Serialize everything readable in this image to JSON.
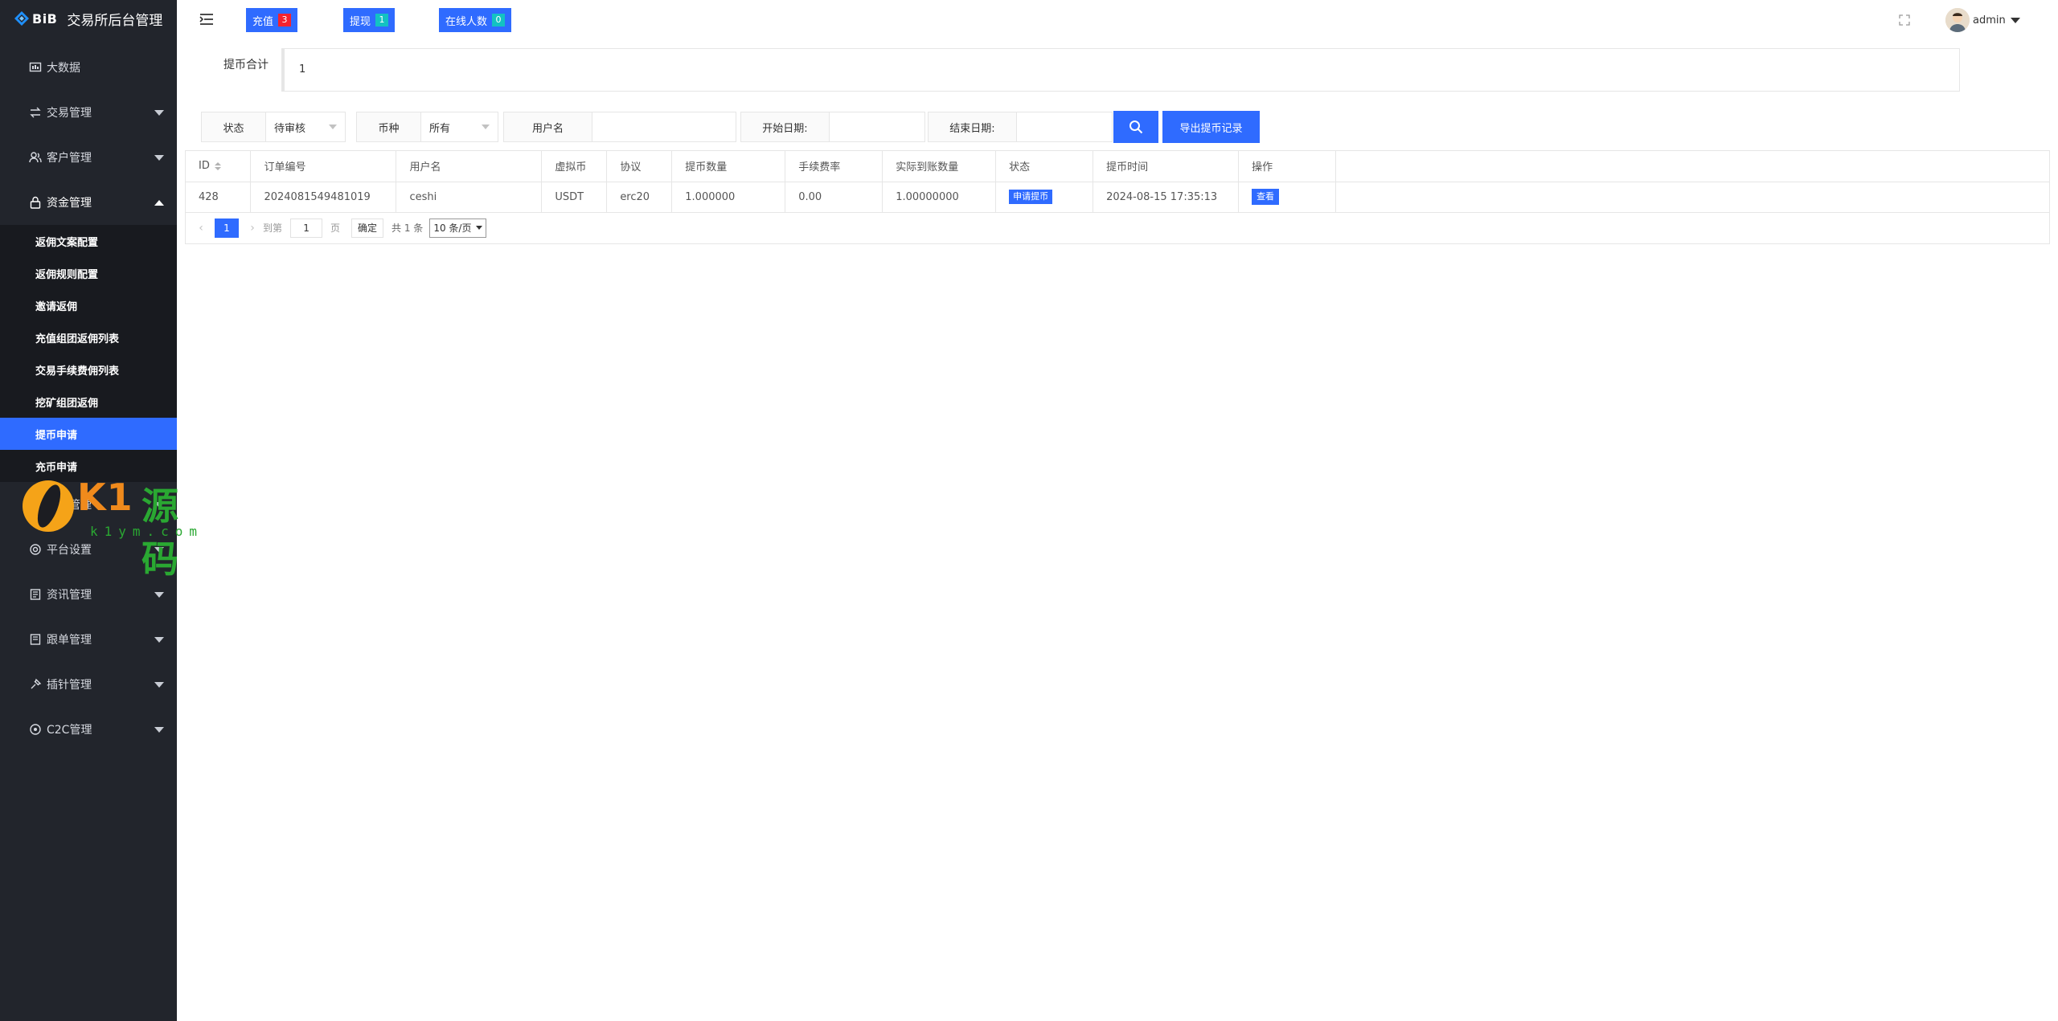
{
  "brand": {
    "mark": "BiB",
    "title": "交易所后台管理"
  },
  "sidebar": {
    "items": [
      {
        "label": "大数据",
        "icon": "dashboard-icon",
        "has_arrow": false
      },
      {
        "label": "交易管理",
        "icon": "exchange-icon",
        "has_arrow": true
      },
      {
        "label": "客户管理",
        "icon": "users-icon",
        "has_arrow": true
      },
      {
        "label": "资金管理",
        "icon": "lock-icon",
        "has_arrow": true,
        "open": true
      }
    ],
    "submenu": [
      "返佣文案配置",
      "返佣规则配置",
      "邀请返佣",
      "充值组团返佣列表",
      "交易手续费佣列表",
      "挖矿组团返佣",
      "提币申请",
      "充币申请"
    ],
    "active_submenu": "提币申请",
    "items_after": [
      {
        "label": "理财管理",
        "icon": "finance-icon"
      },
      {
        "label": "平台设置",
        "icon": "settings-icon"
      },
      {
        "label": "资讯管理",
        "icon": "news-icon"
      },
      {
        "label": "跟单管理",
        "icon": "copy-order-icon"
      },
      {
        "label": "插针管理",
        "icon": "pin-icon"
      },
      {
        "label": "C2C管理",
        "icon": "c2c-icon"
      }
    ]
  },
  "watermark": {
    "text": "K1源码",
    "sub": "k1ym.com"
  },
  "header": {
    "recharge_label": "充值",
    "recharge_count": "3",
    "withdraw_label": "提现",
    "withdraw_count": "1",
    "online_label": "在线人数",
    "online_count": "0",
    "user_name": "admin"
  },
  "summary": {
    "label": "提币合计",
    "value": "1"
  },
  "filters": {
    "status_label": "状态",
    "status_value": "待审核",
    "coin_label": "币种",
    "coin_value": "所有",
    "username_label": "用户名",
    "username_value": "",
    "start_label": "开始日期:",
    "start_value": "",
    "end_label": "结束日期:",
    "end_value": "",
    "export_label": "导出提币记录"
  },
  "table": {
    "columns": [
      "ID",
      "订单编号",
      "用户名",
      "虚拟币",
      "协议",
      "提币数量",
      "手续费率",
      "实际到账数量",
      "状态",
      "提币时间",
      "操作"
    ],
    "rows": [
      {
        "id": "428",
        "order_no": "2024081549481019",
        "username": "ceshi",
        "coin": "USDT",
        "protocol": "erc20",
        "amount": "1.000000",
        "fee_rate": "0.00",
        "actual": "1.00000000",
        "status": "申请提币",
        "time": "2024-08-15 17:35:13",
        "action": "查看"
      }
    ]
  },
  "pager": {
    "current": "1",
    "goto_label": "到第",
    "goto_value": "1",
    "page_label": "页",
    "ok_label": "确定",
    "total": "共 1 条",
    "page_size": "10 条/页"
  },
  "colors": {
    "accent": "#2f6bff",
    "sidebar_bg": "#22252c",
    "submenu_bg": "#181a1f",
    "badge_red": "#f5222d",
    "badge_cyan": "#13c2c2"
  }
}
